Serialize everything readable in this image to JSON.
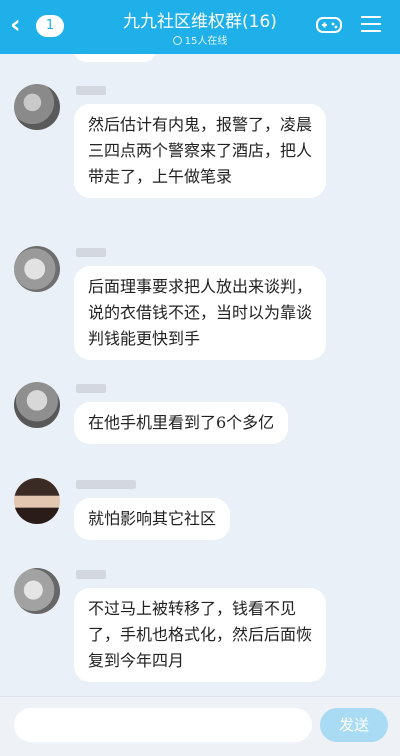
{
  "header": {
    "back_badge": "1",
    "title": "九九社区维权群(16)",
    "online_text": "15人在线"
  },
  "messages": [
    {
      "text": "然后估计有内鬼，报警了，凌晨三四点两个警察来了酒店，把人带走了，上午做笔录"
    },
    {
      "text": "后面理事要求把人放出来谈判，说的衣借钱不还，当时以为靠谈判钱能更快到手"
    },
    {
      "text": "在他手机里看到了6个多亿"
    },
    {
      "text": "就怕影响其它社区"
    },
    {
      "text": "不过马上被转移了，钱看不见了，手机也格式化，然后后面恢复到今年四月"
    }
  ],
  "input": {
    "send_label": "发送"
  }
}
